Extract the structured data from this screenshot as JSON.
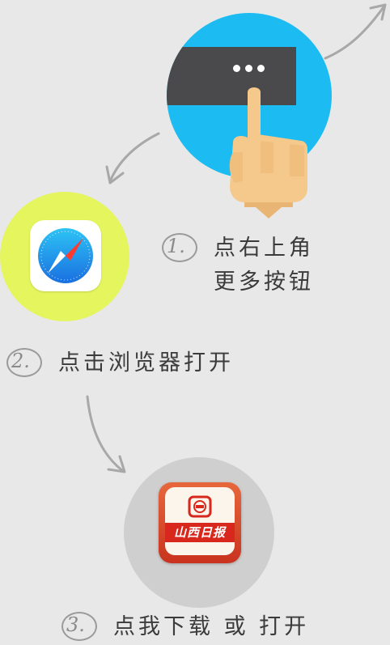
{
  "steps": [
    {
      "number": "1.",
      "line1": "点右上角",
      "line2": "更多按钮",
      "icon": "more-menu-tap-icon",
      "circle_color": "#1cbcf3"
    },
    {
      "number": "2.",
      "line1": "点击浏览器打开",
      "icon": "safari-browser-icon",
      "circle_color": "#e4f55e"
    },
    {
      "number": "3.",
      "line1": "点我下载 或 打开",
      "icon": "app-icon",
      "circle_color": "#cfcfcf",
      "app_name": "山西日报"
    }
  ],
  "colors": {
    "background": "#e8e8e8",
    "text": "#3b3b3b",
    "arrow": "#a8a8a8",
    "menu_bar": "#4a4a4c",
    "app_red": "#d8271c"
  }
}
